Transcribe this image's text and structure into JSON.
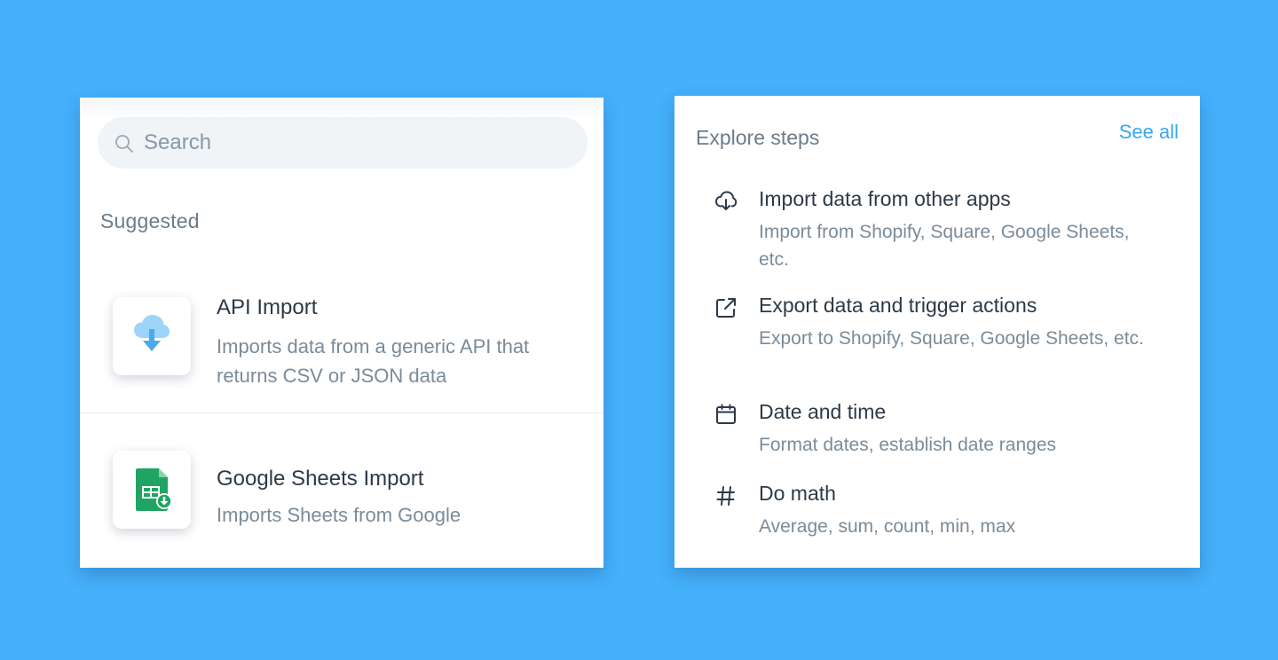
{
  "search": {
    "placeholder": "Search",
    "value": ""
  },
  "suggested": {
    "heading": "Suggested",
    "items": [
      {
        "title": "API Import",
        "description": "Imports data from a generic API that returns CSV or JSON data",
        "icon": "cloud-download-icon"
      },
      {
        "title": "Google Sheets Import",
        "description": "Imports Sheets from Google",
        "icon": "google-sheets-icon"
      }
    ]
  },
  "explore": {
    "heading": "Explore steps",
    "see_all_label": "See all",
    "steps": [
      {
        "title": "Import data from other apps",
        "description": "Import from Shopify, Square, Google Sheets, etc.",
        "icon": "cloud-download-outline-icon"
      },
      {
        "title": "Export data and trigger actions",
        "description": "Export to Shopify, Square, Google Sheets, etc.",
        "icon": "external-link-icon"
      },
      {
        "title": "Date and time",
        "description": "Format dates, establish date ranges",
        "icon": "calendar-icon"
      },
      {
        "title": "Do math",
        "description": "Average, sum, count, min, max",
        "icon": "hash-icon"
      }
    ]
  },
  "colors": {
    "background": "#45b0fb",
    "link": "#3aa7f0",
    "sheets_green": "#1fa463",
    "cloud_blue": "#5ab8f5"
  }
}
